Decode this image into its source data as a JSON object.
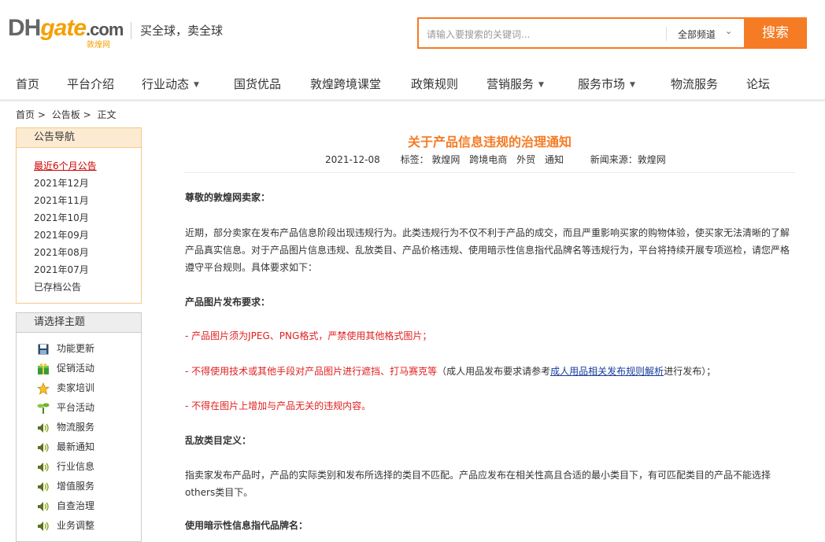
{
  "header": {
    "logo_dh": "DH",
    "logo_gate": "gate",
    "logo_com": ".com",
    "logo_cn": "敦煌网",
    "slogan": "买全球，卖全球",
    "search_placeholder": "请输入要搜索的关键词...",
    "channel": "全部频道",
    "search_button": "搜索"
  },
  "nav": [
    {
      "label": "首页"
    },
    {
      "label": "平台介绍"
    },
    {
      "label": "行业动态"
    },
    {
      "label": "国货优品"
    },
    {
      "label": "敦煌跨境课堂"
    },
    {
      "label": "政策规则"
    },
    {
      "label": "营销服务"
    },
    {
      "label": "服务市场"
    },
    {
      "label": "物流服务"
    },
    {
      "label": "论坛"
    }
  ],
  "breadcrumb": {
    "home": "首页",
    "sep": ">",
    "board": "公告板",
    "current": "正文"
  },
  "announce_nav": {
    "title": "公告导航",
    "items": [
      "最近6个月公告",
      "2021年12月",
      "2021年11月",
      "2021年10月",
      "2021年09月",
      "2021年08月",
      "2021年07月",
      "已存档公告"
    ]
  },
  "topics": {
    "title": "请选择主题",
    "items": [
      {
        "label": "功能更新",
        "icon": "floppy-disk-icon"
      },
      {
        "label": "促销活动",
        "icon": "gift-icon"
      },
      {
        "label": "卖家培训",
        "icon": "star-icon"
      },
      {
        "label": "平台活动",
        "icon": "sprout-icon"
      },
      {
        "label": "物流服务",
        "icon": "speaker-icon"
      },
      {
        "label": "最新通知",
        "icon": "speaker-icon"
      },
      {
        "label": "行业信息",
        "icon": "speaker-icon"
      },
      {
        "label": "增值服务",
        "icon": "speaker-icon"
      },
      {
        "label": "自查治理",
        "icon": "speaker-icon"
      },
      {
        "label": "业务调整",
        "icon": "speaker-icon"
      }
    ]
  },
  "article": {
    "title": "关于产品信息违规的治理通知",
    "date": "2021-12-08",
    "tags_label": "标签：",
    "tags": [
      "敦煌网",
      "跨境电商",
      "外贸",
      "通知"
    ],
    "source": "新闻来源：敦煌网",
    "greeting": "尊敬的敦煌网卖家：",
    "para1_line1": "近期，部分卖家在发布产品信息阶段出现违规行为。此类违规行为不仅不利于产品的成交，而且严重影响买家的购物体验，使买家无法清晰的了解",
    "para1_line2": "产品真实信息。对于产品图片信息违规、乱放类目、产品价格违规、使用暗示性信息指代品牌名等违规行为，平台将持续开展专项巡检，请您严格",
    "para1_line3": "遵守平台规则。具体要求如下：",
    "h_image": "产品图片发布要求：",
    "rule1": "- 产品图片须为JPEG、PNG格式，严禁使用其他格式图片；",
    "rule2_red": "- 不得使用技术或其他手段对产品图片进行遮挡、打马赛克等",
    "rule2_black": "（成人用品发布要求请参考",
    "rule2_link": "成人用品相关发布规则解析",
    "rule2_tail": "进行发布）；",
    "rule3": "- 不得在图片上增加与产品无关的违规内容。",
    "h_category": "乱放类目定义：",
    "cat_line1": "指卖家发布产品时，产品的实际类别和发布所选择的类目不匹配。产品应发布在相关性高且合适的最小类目下，有可匹配类目的产品不能选择",
    "cat_line2": "others类目下。",
    "h_brand": "使用暗示性信息指代品牌名："
  }
}
